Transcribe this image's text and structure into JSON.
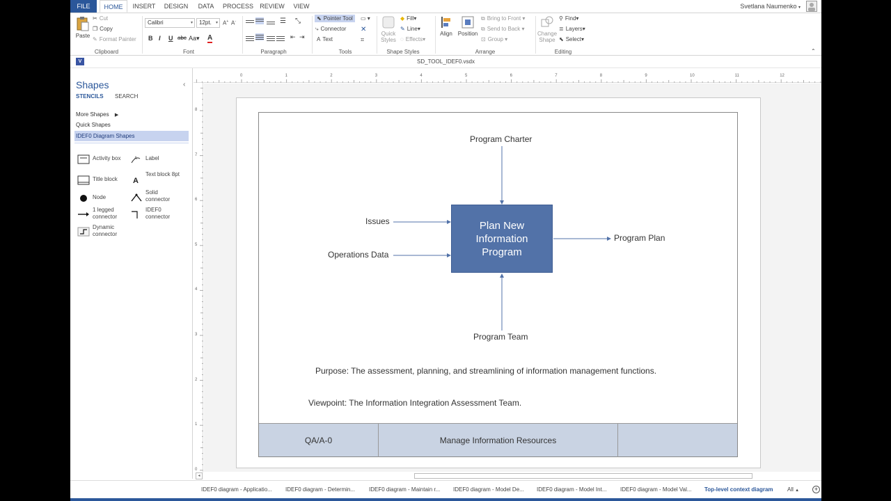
{
  "ribbon_tabs": [
    "FILE",
    "HOME",
    "INSERT",
    "DESIGN",
    "DATA",
    "PROCESS",
    "REVIEW",
    "VIEW"
  ],
  "active_tab": "HOME",
  "user_name": "Svetlana Naumenko",
  "clipboard": {
    "paste": "Paste",
    "cut": "Cut",
    "copy": "Copy",
    "format_painter": "Format Painter",
    "label": "Clipboard"
  },
  "font": {
    "family": "Calibri",
    "size": "12pt.",
    "label": "Font"
  },
  "paragraph": {
    "label": "Paragraph"
  },
  "tools": {
    "pointer": "Pointer Tool",
    "connector": "Connector",
    "text": "Text",
    "label": "Tools"
  },
  "shape_styles": {
    "quick_styles": "Quick Styles",
    "fill": "Fill",
    "line": "Line",
    "effects": "Effects",
    "label": "Shape Styles"
  },
  "arrange": {
    "align": "Align",
    "position": "Position",
    "bring_to_front": "Bring to Front",
    "send_to_back": "Send to Back",
    "group": "Group",
    "label": "Arrange"
  },
  "editing": {
    "change_shape": "Change Shape",
    "find": "Find",
    "layers": "Layers",
    "select": "Select",
    "label": "Editing"
  },
  "document_title": "SD_TOOL_IDEF0.vsdx",
  "shapes_pane": {
    "title": "Shapes",
    "tab_stencils": "STENCILS",
    "tab_search": "SEARCH",
    "stencils": [
      "More Shapes",
      "Quick Shapes",
      "IDEF0 Diagram Shapes"
    ],
    "selected_stencil": "IDEF0 Diagram Shapes",
    "shapes": [
      {
        "label": "Activity box",
        "icon": "activity-box-icon"
      },
      {
        "label": "Label",
        "icon": "label-icon"
      },
      {
        "label": "Title block",
        "icon": "title-block-icon"
      },
      {
        "label": "Text block 8pt",
        "icon": "text-block-icon"
      },
      {
        "label": "Node",
        "icon": "node-icon"
      },
      {
        "label": "Solid connector",
        "icon": "solid-connector-icon"
      },
      {
        "label": "1 legged connector",
        "icon": "one-legged-connector-icon"
      },
      {
        "label": "IDEF0 connector",
        "icon": "idef0-connector-icon"
      },
      {
        "label": "Dynamic connector",
        "icon": "dynamic-connector-icon"
      }
    ]
  },
  "ruler": {
    "horizontal": [
      "0",
      "1",
      "2",
      "3",
      "4",
      "5",
      "6",
      "7",
      "8",
      "9",
      "10",
      "11",
      "12"
    ],
    "vertical": [
      "8",
      "7",
      "6",
      "5",
      "4",
      "3",
      "2",
      "1",
      "0"
    ]
  },
  "diagram": {
    "activity": "Plan New Information Program",
    "control": "Program Charter",
    "inputs": [
      "Issues",
      "Operations Data"
    ],
    "output": "Program Plan",
    "mechanism": "Program Team",
    "purpose": "Purpose:  The assessment, planning, and streamlining of information management functions.",
    "viewpoint": "Viewpoint:  The Information Integration Assessment Team.",
    "title_block": {
      "node": "QA/A-0",
      "title": "Manage Information Resources",
      "number": ""
    }
  },
  "page_tabs": [
    "IDEF0 diagram - Applicatio...",
    "IDEF0 diagram - Determin...",
    "IDEF0 diagram - Maintain r...",
    "IDEF0 diagram - Model De...",
    "IDEF0 diagram - Model Int...",
    "IDEF0 diagram - Model Val...",
    "Top-level context diagram"
  ],
  "active_page_tab": "Top-level context diagram",
  "all_pages": "All"
}
